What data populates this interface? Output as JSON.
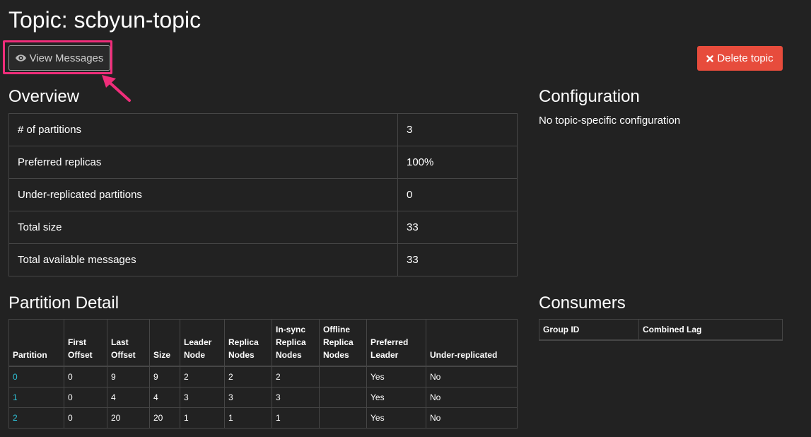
{
  "page": {
    "title": "Topic: scbyun-topic"
  },
  "actions": {
    "view_messages_label": "View Messages",
    "view_messages_icon": "eye-icon",
    "delete_label": "Delete topic",
    "delete_icon": "close-icon",
    "highlight_color": "#ef2d7a",
    "delete_color": "#e74c3c"
  },
  "overview": {
    "heading": "Overview",
    "rows": [
      {
        "label": "# of partitions",
        "value": "3"
      },
      {
        "label": "Preferred replicas",
        "value": "100%"
      },
      {
        "label": "Under-replicated partitions",
        "value": "0"
      },
      {
        "label": "Total size",
        "value": "33"
      },
      {
        "label": "Total available messages",
        "value": "33"
      }
    ]
  },
  "configuration": {
    "heading": "Configuration",
    "text": "No topic-specific configuration"
  },
  "partition_detail": {
    "heading": "Partition Detail",
    "columns": [
      "Partition",
      "First Offset",
      "Last Offset",
      "Size",
      "Leader Node",
      "Replica Nodes",
      "In-sync Replica Nodes",
      "Offline Replica Nodes",
      "Preferred Leader",
      "Under-replicated"
    ],
    "rows": [
      {
        "partition": "0",
        "first_offset": "0",
        "last_offset": "9",
        "size": "9",
        "leader": "2",
        "replicas": "2",
        "in_sync": "2",
        "offline": "",
        "preferred": "Yes",
        "under_replicated": "No"
      },
      {
        "partition": "1",
        "first_offset": "0",
        "last_offset": "4",
        "size": "4",
        "leader": "3",
        "replicas": "3",
        "in_sync": "3",
        "offline": "",
        "preferred": "Yes",
        "under_replicated": "No"
      },
      {
        "partition": "2",
        "first_offset": "0",
        "last_offset": "20",
        "size": "20",
        "leader": "1",
        "replicas": "1",
        "in_sync": "1",
        "offline": "",
        "preferred": "Yes",
        "under_replicated": "No"
      }
    ]
  },
  "consumers": {
    "heading": "Consumers",
    "columns": [
      "Group ID",
      "Combined Lag"
    ]
  }
}
